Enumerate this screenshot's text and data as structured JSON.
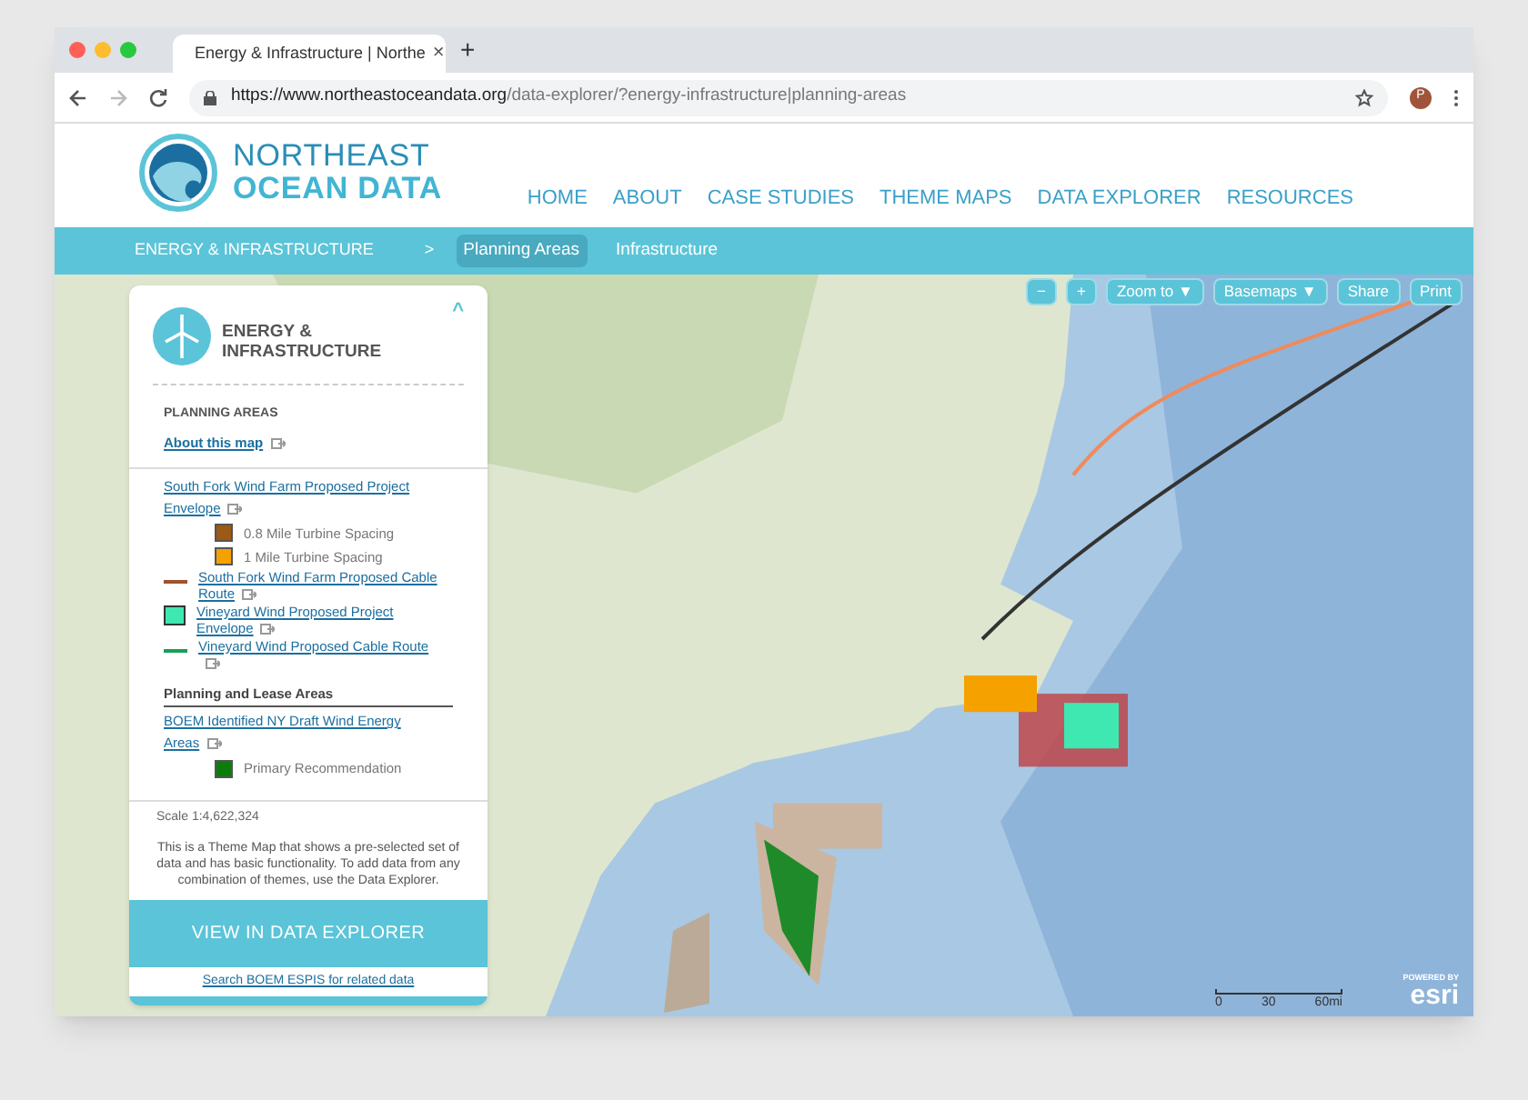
{
  "browser": {
    "tab_title": "Energy & Infrastructure | Northe",
    "close": "×",
    "new_tab": "+",
    "url_host": "https://www.northeastoceandata.org",
    "url_path": "/data-explorer/?energy-infrastructure|planning-areas",
    "avatar": "P"
  },
  "site": {
    "logo_line1": "NORTHEAST",
    "logo_line2": "OCEAN DATA",
    "nav": [
      {
        "label": "HOME"
      },
      {
        "label": "ABOUT"
      },
      {
        "label": "CASE STUDIES"
      },
      {
        "label": "THEME MAPS"
      },
      {
        "label": "DATA EXPLORER"
      },
      {
        "label": "RESOURCES"
      }
    ]
  },
  "breadcrumb": {
    "section": "ENERGY & INFRASTRUCTURE",
    "separator": ">",
    "tabs": [
      {
        "label": "Planning Areas",
        "selected": true
      },
      {
        "label": "Infrastructure",
        "selected": false
      }
    ]
  },
  "map_controls": [
    {
      "label": "−"
    },
    {
      "label": "+"
    },
    {
      "label": "Zoom to ▼"
    },
    {
      "label": "Basemaps ▼"
    },
    {
      "label": "Share"
    },
    {
      "label": "Print"
    }
  ],
  "panel": {
    "title_line1": "ENERGY &",
    "title_line2": "INFRASTRUCTURE",
    "collapse": "^",
    "section": "PLANNING AREAS",
    "about_link": "About this map",
    "legend": [
      {
        "kind": "link",
        "label": "South Fork Wind Farm Proposed Project Envelope"
      },
      {
        "kind": "swatch",
        "label": "0.8 Mile Turbine Spacing",
        "color": "#9c5a14"
      },
      {
        "kind": "swatch",
        "label": "1 Mile Turbine Spacing",
        "color": "#f5a100"
      },
      {
        "kind": "line",
        "label": "South Fork Wind Farm Proposed Cable Route",
        "color": "#a0522d"
      },
      {
        "kind": "box",
        "label": "Vineyard Wind Proposed Project Envelope",
        "color": "#3ee8b0"
      },
      {
        "kind": "line",
        "label": "Vineyard Wind Proposed Cable Route",
        "color": "#1a9e5a"
      },
      {
        "kind": "heading",
        "label": "Planning and Lease Areas"
      },
      {
        "kind": "link",
        "label": "BOEM Identified NY Draft Wind Energy Areas"
      },
      {
        "kind": "swatch",
        "label": "Primary Recommendation",
        "color": "#0a7d0a"
      }
    ],
    "scale": "Scale 1:4,622,324",
    "description": "This is a Theme Map that shows a pre-selected set of data and has basic functionality. To add data from any combination of themes, use the Data Explorer.",
    "cta": "VIEW IN DATA EXPLORER",
    "search_link": "Search BOEM ESPIS for related data"
  },
  "scalebar": {
    "ticks": [
      "0",
      "30",
      "60mi"
    ]
  },
  "attribution": {
    "small": "POWERED BY",
    "brand": "esri"
  }
}
